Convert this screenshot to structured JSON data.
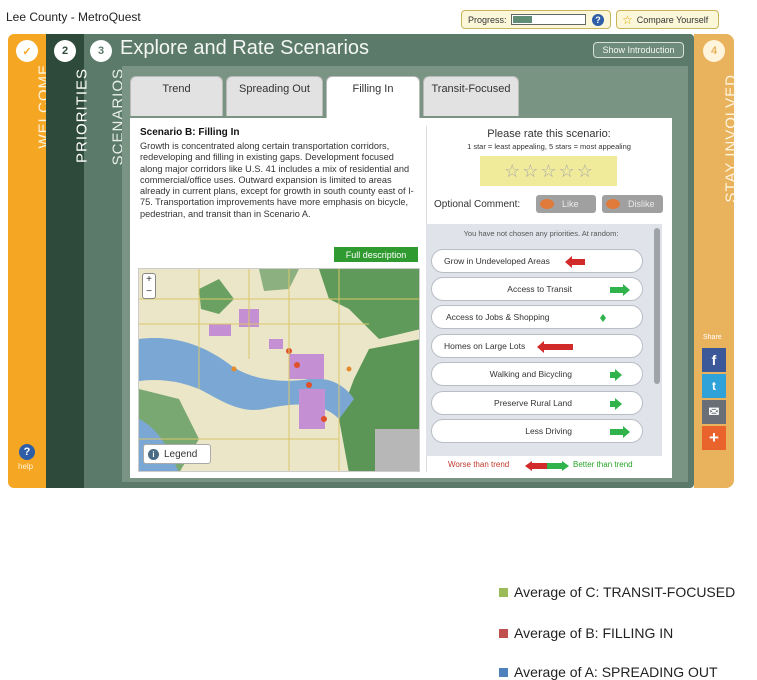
{
  "app": {
    "title": "Lee County - MetroQuest"
  },
  "progress": {
    "label": "Progress:",
    "value": 0.25
  },
  "compare": {
    "label": "Compare Yourself",
    "icon": "star-icon"
  },
  "nav": {
    "welcome": {
      "step": "✓",
      "label": "WELCOME",
      "help": "help"
    },
    "priorities": {
      "step": "2",
      "label": "PRIORITIES"
    },
    "scenarios": {
      "step": "3",
      "label": "SCENARIOS"
    },
    "stay_involved": {
      "step": "4",
      "label": "STAY INVOLVED",
      "share": "Share"
    }
  },
  "scenarios_page": {
    "title": "Explore and Rate Scenarios",
    "intro_button": "Show Introduction",
    "tabs": [
      {
        "label": "Trend"
      },
      {
        "label": "Spreading Out"
      },
      {
        "label": "Filling In",
        "active": true
      },
      {
        "label": "Transit-Focused"
      }
    ],
    "scenario": {
      "title": "Scenario B: Filling In",
      "description": "Growth is concentrated along certain transportation corridors, redeveloping and filling in existing gaps. Development focused along major corridors like U.S. 41 includes a mix of residential and commercial/office uses. Outward expansion is limited to areas already in current plans, except for growth in south county east of I-75. Transportation improvements have more emphasis on bicycle, pedestrian, and transit than in Scenario A.",
      "full_description": "Full description",
      "legend_label": "Legend"
    },
    "rating": {
      "prompt": "Please rate this scenario:",
      "scale_note": "1 star = least appealing, 5 stars = most appealing",
      "stars": 5,
      "selected": 0,
      "comment_label": "Optional Comment:",
      "like": "Like",
      "dislike": "Dislike"
    },
    "priorities": {
      "note": "You have not chosen any priorities. At random:",
      "items": [
        {
          "label": "Grow in Undeveloped Areas",
          "direction": "worse",
          "strength": "medium"
        },
        {
          "label": "Access to Transit",
          "direction": "better",
          "strength": "medium"
        },
        {
          "label": "Access to Jobs & Shopping",
          "direction": "neutral",
          "strength": "small"
        },
        {
          "label": "Homes on Large Lots",
          "direction": "worse",
          "strength": "large"
        },
        {
          "label": "Walking and Bicycling",
          "direction": "better",
          "strength": "small"
        },
        {
          "label": "Preserve Rural Land",
          "direction": "better",
          "strength": "small"
        },
        {
          "label": "Less Driving",
          "direction": "better",
          "strength": "medium"
        }
      ],
      "worse_label": "Worse than trend",
      "better_label": "Better than trend"
    }
  },
  "chart_legend": {
    "items": [
      {
        "label": "Average of C: TRANSIT-FOCUSED",
        "color": "#9bbb59"
      },
      {
        "label": "Average of B: FILLING IN",
        "color": "#c0504d"
      },
      {
        "label": "Average of A: SPREADING OUT",
        "color": "#4f81bd"
      }
    ]
  }
}
